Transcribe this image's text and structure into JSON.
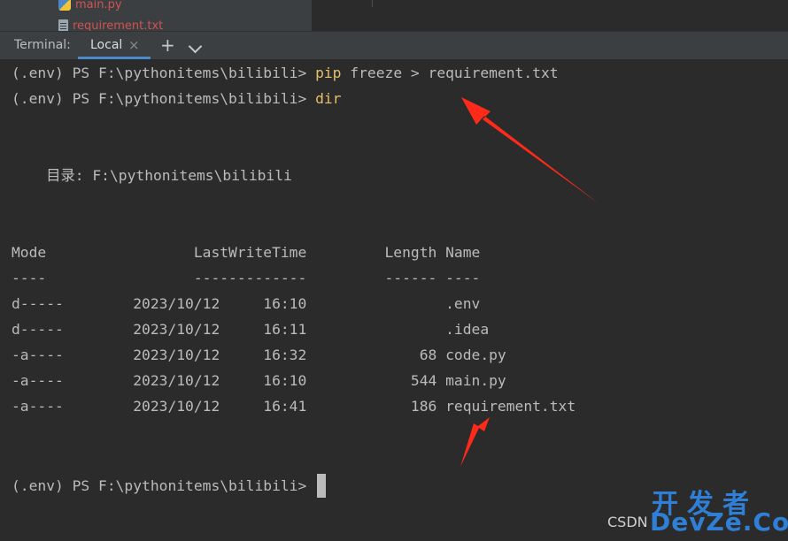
{
  "project_tree": {
    "items": [
      {
        "label": "main.py",
        "icon": "python-file-icon"
      },
      {
        "label": "requirement.txt",
        "icon": "text-file-icon"
      }
    ]
  },
  "tabbar": {
    "title": "Terminal:",
    "tab_label": "Local",
    "close_glyph": "×",
    "add_glyph": "+"
  },
  "terminal": {
    "prompt": "(.env) PS F:\\pythonitems\\bilibili> ",
    "line1_cmd_pip": "pip",
    "line1_cmd_rest": " freeze > requirement.txt",
    "line2_cmd": "dir",
    "directory_line": "    目录: F:\\pythonitems\\bilibili",
    "header": "Mode                 LastWriteTime         Length Name",
    "separator": "----                 -------------         ------ ----",
    "rows": [
      "d-----        2023/10/12     16:10                .env",
      "d-----        2023/10/12     16:11                .idea",
      "-a----        2023/10/12     16:32             68 code.py",
      "-a----        2023/10/12     16:10            544 main.py",
      "-a----        2023/10/12     16:41            186 requirement.txt"
    ],
    "final_prompt": "(.env) PS F:\\pythonitems\\bilibili> "
  },
  "listing": {
    "columns": [
      "Mode",
      "LastWriteTime",
      "Length",
      "Name"
    ],
    "entries": [
      {
        "mode": "d-----",
        "date": "2023/10/12",
        "time": "16:10",
        "length": "",
        "name": ".env"
      },
      {
        "mode": "d-----",
        "date": "2023/10/12",
        "time": "16:11",
        "length": "",
        "name": ".idea"
      },
      {
        "mode": "-a----",
        "date": "2023/10/12",
        "time": "16:32",
        "length": "68",
        "name": "code.py"
      },
      {
        "mode": "-a----",
        "date": "2023/10/12",
        "time": "16:10",
        "length": "544",
        "name": "main.py"
      },
      {
        "mode": "-a----",
        "date": "2023/10/12",
        "time": "16:41",
        "length": "186",
        "name": "requirement.txt"
      }
    ]
  },
  "watermark": {
    "csdn": "CSDN",
    "brand_cn": "开发者",
    "brand_en": "DevZe.CoM"
  },
  "colors": {
    "terminal_bg": "#2b2b2b",
    "terminal_text": "#bbbbbb",
    "command_text": "#e8bf6a",
    "tab_accent": "#4a88c7",
    "annotation_arrow": "#ff2a1a",
    "watermark_blue": "#2f7fd6"
  }
}
